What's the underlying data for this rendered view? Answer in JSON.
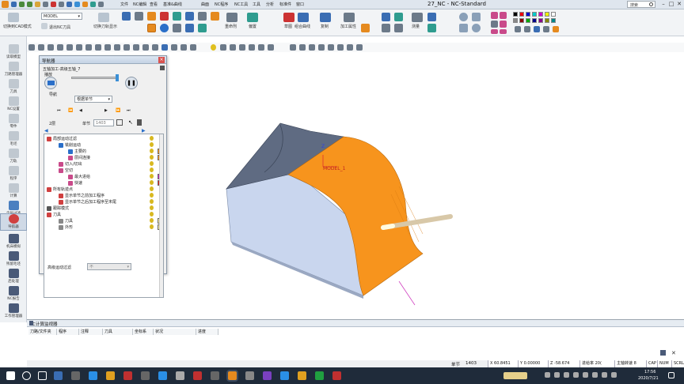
{
  "window": {
    "title": "27_NC - NC-Standard",
    "menu": [
      "文件",
      "NC编辑",
      "查看",
      "基准&曲线",
      "曲面",
      "NC程序",
      "NC工具",
      "工具",
      "分析",
      "标准件",
      "窗口"
    ],
    "search_placeholder": "搜索"
  },
  "ribbon": {
    "model_select": "MODEL",
    "buttons": [
      {
        "label": "切换到CAD模式"
      },
      {
        "label": "退出NC刀具"
      },
      {
        "label": "切换刀轨显示"
      },
      {
        "label": "重命刑"
      },
      {
        "label": "偏置"
      },
      {
        "label": "草图"
      },
      {
        "label": "组合曲线"
      },
      {
        "label": "复制"
      },
      {
        "label": "加工属性"
      },
      {
        "label": "测量"
      }
    ]
  },
  "sidebar": {
    "items": [
      "读取模型",
      "刀路管理器",
      "刀具",
      "NC设置",
      "零件",
      "毛坯",
      "刀轨",
      "程序",
      "计算",
      "全局过滤",
      "导航器",
      "机床模拟",
      "残留毛坯",
      "后处理",
      "NC报告",
      "工作管理器"
    ]
  },
  "navigator": {
    "title": "导航器",
    "program_name": "五轴加工-高级五轴_7",
    "play_label": "播放",
    "nav_label": "导航",
    "mode_select": "根据单节",
    "layer_label": "2层",
    "block_label": "单节",
    "block_value": "1403",
    "tree": [
      {
        "label": "局部运动过滤"
      },
      {
        "label": "铣削运动"
      },
      {
        "label": "主要的"
      },
      {
        "label": "层间连接"
      },
      {
        "label": "切入/切出"
      },
      {
        "label": "空切"
      },
      {
        "label": "最大进给"
      },
      {
        "label": "快速"
      },
      {
        "label": "所有轨迹点"
      },
      {
        "label": "显示单节之前加工程序"
      },
      {
        "label": "显示单节之后加工程序至末尾"
      },
      {
        "label": "跟踪模式"
      },
      {
        "label": "刀具"
      },
      {
        "label": "刀具"
      },
      {
        "label": "外形"
      }
    ],
    "advanced_filter_label": "高级运动过滤",
    "advanced_filter_value": "不"
  },
  "viewport": {
    "model_label": "MODEL_1",
    "axis_x": "X",
    "axis_z": "Z"
  },
  "monitor": {
    "title": "NC计算监视器",
    "columns": [
      "刀路/文件夹",
      "程序",
      "注释",
      "刀具",
      "坐标系",
      "状况",
      "进度"
    ]
  },
  "status": {
    "block_label": "单节",
    "block_value": "1403",
    "x": "X  60.8451",
    "y": "Y  0.00000",
    "z": "Z  -58.674",
    "feed": "进给率  20(",
    "spindle": "主轴转速  8",
    "cap": "CAP",
    "num": "NUM",
    "scrl": "SCRL"
  },
  "taskbar": {
    "time": "17:56",
    "date": "2020/7/21"
  },
  "colors": {
    "orange": "#f7941d",
    "slate": "#5f6b82",
    "side_face": "#c9d6ee",
    "ribbon_bg": "#f2f4f6",
    "taskbar": "#1f2b3a"
  }
}
